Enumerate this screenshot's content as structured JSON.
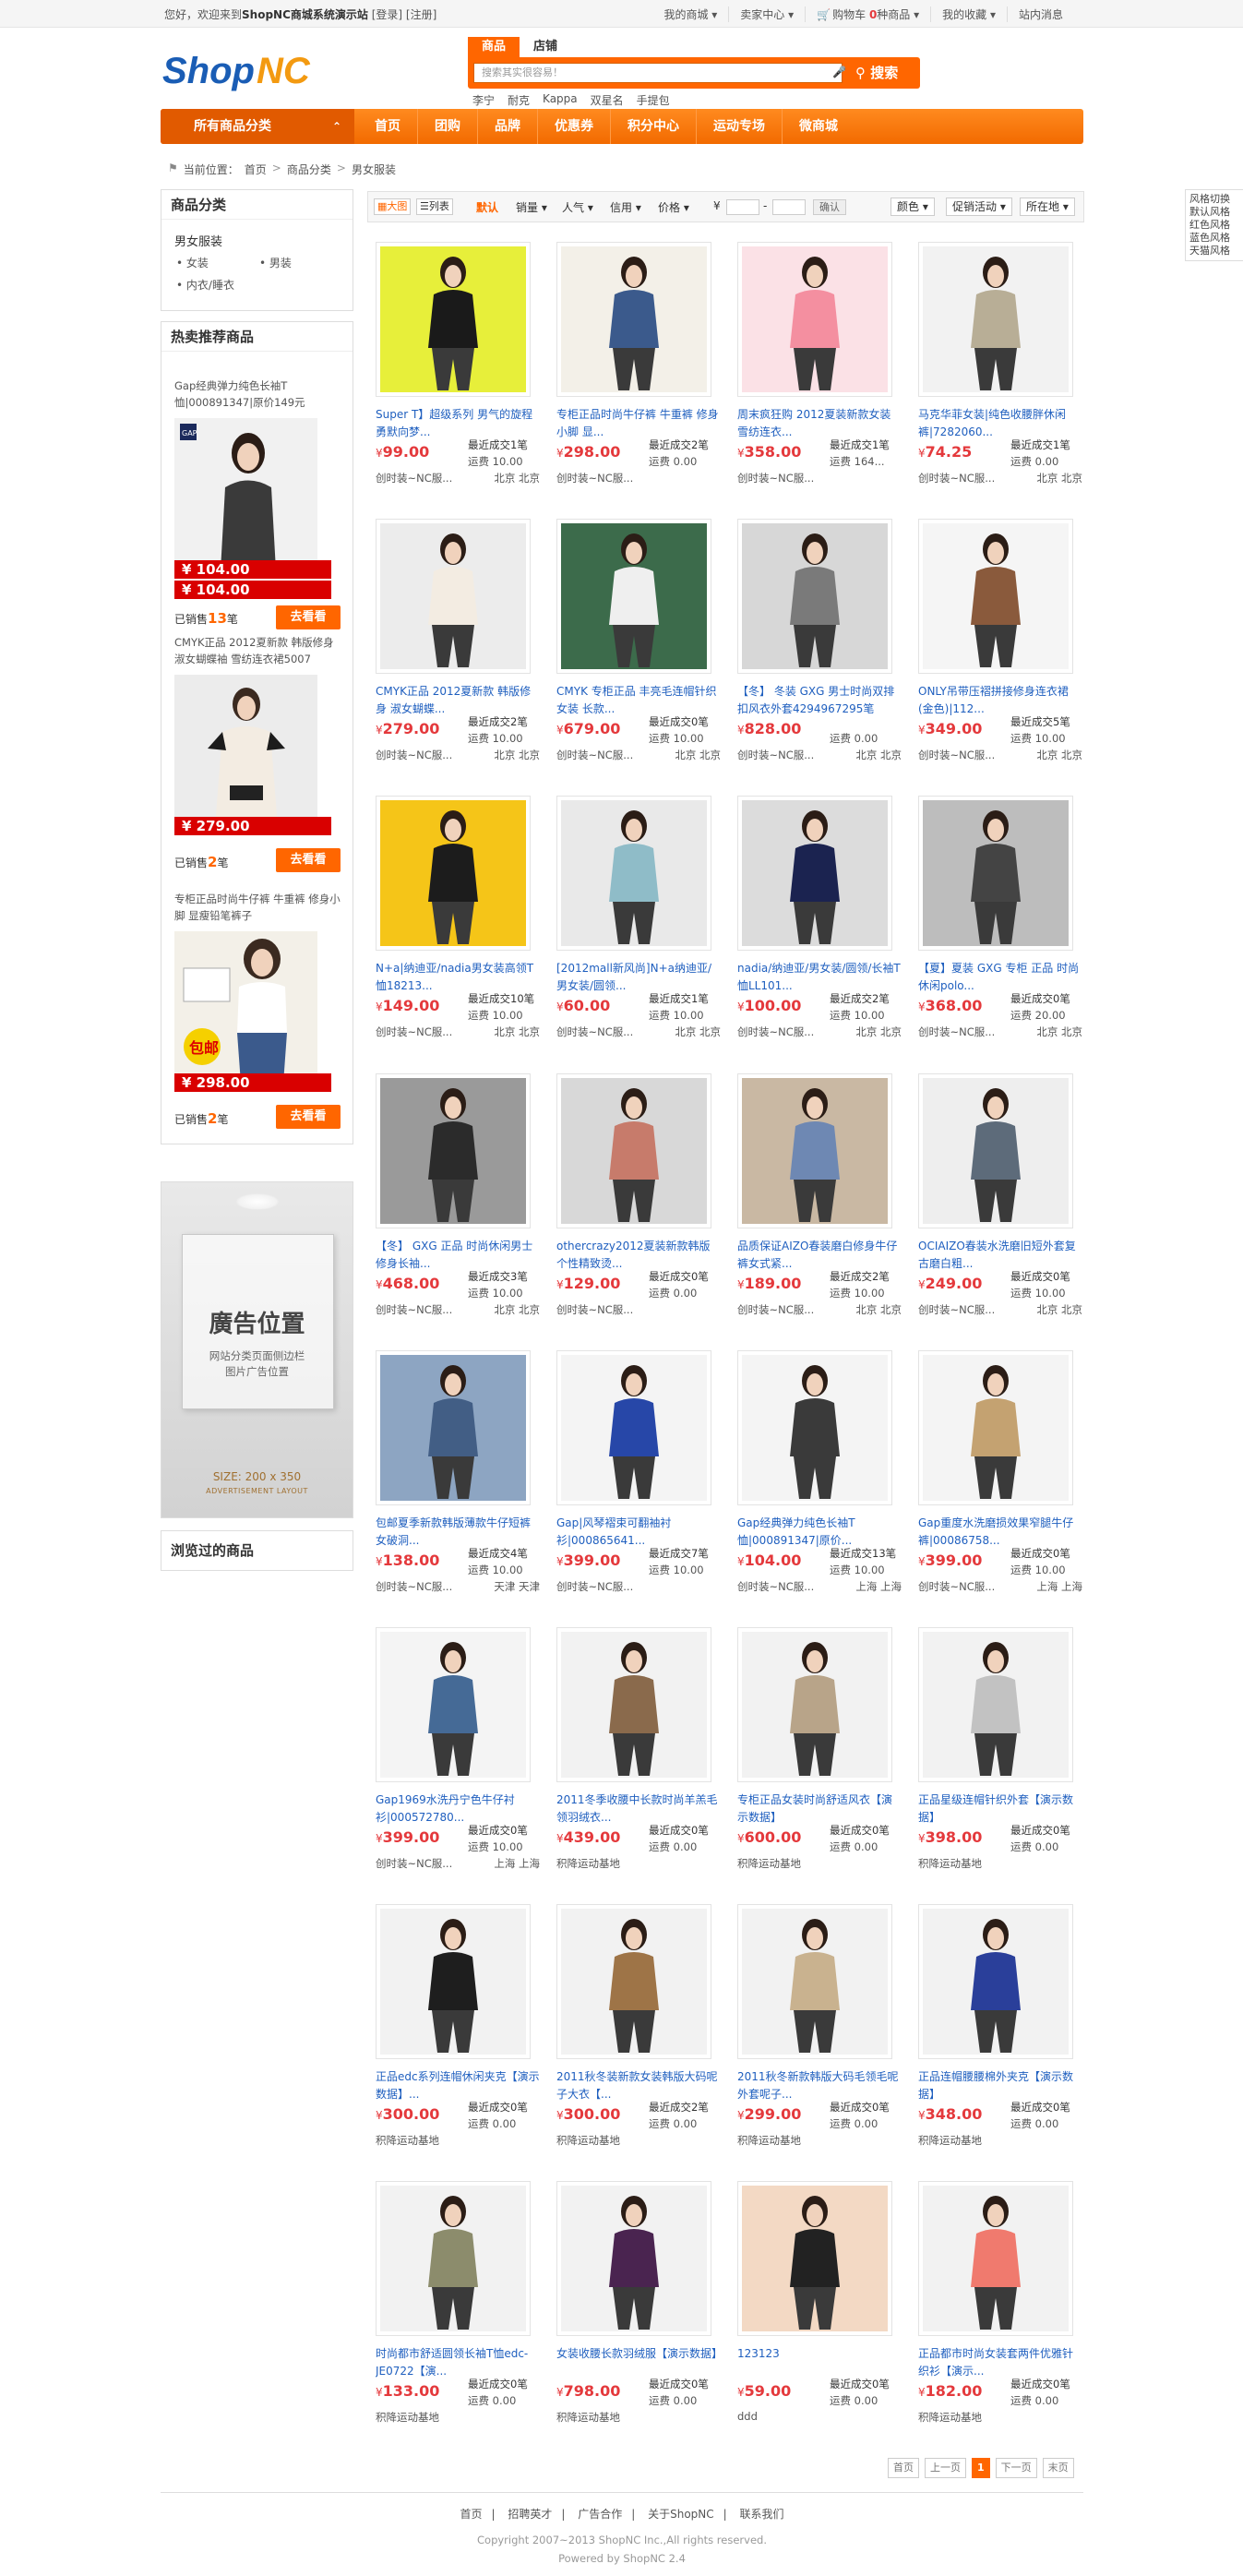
{
  "topbar": {
    "welcome": "您好，欢迎来到",
    "site_name": "ShopNC商城系统演示站",
    "login": "[登录]",
    "register": "[注册]",
    "links": [
      "我的商城 ▾",
      "卖家中心 ▾",
      "购物车",
      "我的收藏 ▾",
      "站内消息"
    ],
    "cart_count": "0",
    "cart_suffix": "种商品 ▾"
  },
  "logo": {
    "text": "ShopNC"
  },
  "search": {
    "tabs": [
      "商品",
      "店铺"
    ],
    "placeholder": "搜索其实很容易！",
    "button": "搜索",
    "hotwords": [
      "李宁",
      "耐克",
      "Kappa",
      "双星名",
      "手提包"
    ]
  },
  "nav": {
    "all_categories": "所有商品分类",
    "items": [
      "首页",
      "团购",
      "品牌",
      "优惠券",
      "积分中心",
      "运动专场",
      "微商城"
    ]
  },
  "breadcrumb": {
    "label": "当前位置：",
    "items": [
      "首页",
      "商品分类",
      "男女服装"
    ]
  },
  "style_panel": {
    "title": "风格切换",
    "items": [
      "默认风格",
      "红色风格",
      "蓝色风格",
      "天猫风格"
    ]
  },
  "sidebar": {
    "category_title": "商品分类",
    "category_main": "男女服装",
    "subcategories": [
      "女装",
      "男装",
      "内衣/睡衣"
    ],
    "hot_title": "热卖推荐商品",
    "hot_items": [
      {
        "name": "Gap经典弹力纯色长袖T恤|000891347|原价149元",
        "price": "¥ 104.00",
        "sold_prefix": "已销售",
        "sold": "13",
        "sold_suffix": "笔",
        "button": "去看看"
      },
      {
        "name": "CMYK正品 2012夏新款 韩版修身 淑女蝴蝶袖 雪纺连衣裙5007",
        "price": "¥ 279.00",
        "sold_prefix": "已销售",
        "sold": "2",
        "sold_suffix": "笔",
        "button": "去看看"
      },
      {
        "name": "专柜正品时尚牛仔裤 牛重裤 修身小脚 显瘦铅笔裤子",
        "price": "¥ 298.00",
        "sold_prefix": "已销售",
        "sold": "2",
        "sold_suffix": "笔",
        "button": "去看看"
      }
    ],
    "ad": {
      "title": "廣告位置",
      "subtitle1": "网站分类页面侧边栏",
      "subtitle2": "图片广告位置",
      "size": "SIZE: 200 x 350",
      "size_sub": "ADVERTISEMENT LAYOUT"
    },
    "viewed_title": "浏览过的商品"
  },
  "toolbar": {
    "view_grid": "大图",
    "view_list": "列表",
    "sorts": [
      "默认",
      "销量 ▾",
      "人气 ▾",
      "信用 ▾",
      "价格 ▾"
    ],
    "currency": "¥",
    "dash": "-",
    "go": "确认",
    "filters": [
      "颜色 ▾",
      "促销活动 ▾",
      "所在地 ▾"
    ]
  },
  "products": [
    {
      "name": "Super T】超级系列 男气的旋程 勇默向梦...",
      "price": "99.00",
      "sold": "最近成交1笔",
      "ship": "运费 10.00",
      "store": "创时装~NC服...",
      "loc": "北京 北京",
      "c1": "#e7ef3a",
      "c2": "#1a1a1a"
    },
    {
      "name": "专柜正品时尚牛仔裤 牛重裤 修身小脚 显...",
      "price": "298.00",
      "sold": "最近成交2笔",
      "ship": "运费 0.00",
      "store": "创时装~NC服...",
      "loc": "",
      "c1": "#f3f0e8",
      "c2": "#3b5a8c"
    },
    {
      "name": "周末疯狂购 2012夏装新款女装 雪纺连衣...",
      "price": "358.00",
      "sold": "最近成交1笔",
      "ship": "运费 164...",
      "store": "创时装~NC服...",
      "loc": "",
      "c1": "#fbe1e6",
      "c2": "#f48fa0"
    },
    {
      "name": "马克华菲女装|纯色收腰胖休闲裤|7282060...",
      "price": "74.25",
      "sold": "最近成交1笔",
      "ship": "运费 0.00",
      "store": "创时装~NC服...",
      "loc": "北京 北京",
      "c1": "#f2f2f2",
      "c2": "#b8ae96"
    },
    {
      "name": "CMYK正品 2012夏新款 韩版修身 淑女蝴蝶...",
      "price": "279.00",
      "sold": "最近成交2笔",
      "ship": "运费 10.00",
      "store": "创时装~NC服...",
      "loc": "北京 北京",
      "c1": "#ececec",
      "c2": "#f3ece2"
    },
    {
      "name": "CMYK 专柜正品 丰亮毛连帽针织女装 长款...",
      "price": "679.00",
      "sold": "最近成交0笔",
      "ship": "运费 10.00",
      "store": "创时装~NC服...",
      "loc": "北京 北京",
      "c1": "#3c6b4b",
      "c2": "#efefef"
    },
    {
      "name": "【冬】 冬装 GXG 男士时尚双排扣风衣外套4294967295笔",
      "price": "828.00",
      "sold": "",
      "ship": "运费 0.00",
      "store": "创时装~NC服...",
      "loc": "北京 北京",
      "c1": "#d7d7d7",
      "c2": "#7a7a7a"
    },
    {
      "name": "ONLY吊带压褶拼接修身连衣裙(金色)|112...",
      "price": "349.00",
      "sold": "最近成交5笔",
      "ship": "运费 10.00",
      "store": "创时装~NC服...",
      "loc": "北京 北京",
      "c1": "#f5f5f5",
      "c2": "#8a5a3c"
    },
    {
      "name": "N+a|纳迪亚/nadia男女装高领T恤18213...",
      "price": "149.00",
      "sold": "最近成交10笔",
      "ship": "运费 10.00",
      "store": "创时装~NC服...",
      "loc": "北京 北京",
      "c1": "#f5c518",
      "c2": "#1c1c1c"
    },
    {
      "name": "[2012mall新风尚]N+a纳迪亚/男女装/圆领...",
      "price": "60.00",
      "sold": "最近成交1笔",
      "ship": "运费 10.00",
      "store": "创时装~NC服...",
      "loc": "北京 北京",
      "c1": "#e9e9e9",
      "c2": "#8fbcc8"
    },
    {
      "name": "nadia/纳迪亚/男女装/圆领/长袖T恤LL101...",
      "price": "100.00",
      "sold": "最近成交2笔",
      "ship": "运费 10.00",
      "store": "创时装~NC服...",
      "loc": "北京 北京",
      "c1": "#dcdcdc",
      "c2": "#1b2350"
    },
    {
      "name": "【夏】夏装 GXG 专柜 正品 时尚休闲polo...",
      "price": "368.00",
      "sold": "最近成交0笔",
      "ship": "运费 20.00",
      "store": "创时装~NC服...",
      "loc": "北京 北京",
      "c1": "#bdbdbd",
      "c2": "#444"
    },
    {
      "name": "【冬】 GXG 正品 时尚休闲男士修身长袖...",
      "price": "468.00",
      "sold": "最近成交3笔",
      "ship": "运费 10.00",
      "store": "创时装~NC服...",
      "loc": "北京 北京",
      "c1": "#9a9a9a",
      "c2": "#2b2b2b"
    },
    {
      "name": "othercrazy2012夏装新款韩版个性精致烫...",
      "price": "129.00",
      "sold": "最近成交0笔",
      "ship": "运费 0.00",
      "store": "创时装~NC服...",
      "loc": "",
      "c1": "#d8d8d8",
      "c2": "#c77b6b"
    },
    {
      "name": "品质保证AIZO春装磨白修身牛仔裤女式紧...",
      "price": "189.00",
      "sold": "最近成交2笔",
      "ship": "运费 10.00",
      "store": "创时装~NC服...",
      "loc": "北京 北京",
      "c1": "#c9b8a3",
      "c2": "#6e88b3"
    },
    {
      "name": "OCIAIZO春装水洗磨旧短外套复古磨白粗...",
      "price": "249.00",
      "sold": "最近成交0笔",
      "ship": "运费 10.00",
      "store": "创时装~NC服...",
      "loc": "北京 北京",
      "c1": "#eeeeee",
      "c2": "#5d6b7a"
    },
    {
      "name": "包邮夏季新款韩版薄款牛仔短裤女破洞...",
      "price": "138.00",
      "sold": "最近成交4笔",
      "ship": "运费 10.00",
      "store": "创时装~NC服...",
      "loc": "天津 天津",
      "c1": "#8da5c2",
      "c2": "#425e85"
    },
    {
      "name": "Gap|风琴褶束可翻袖衬衫|000865641...",
      "price": "399.00",
      "sold": "最近成交7笔",
      "ship": "运费 10.00",
      "store": "创时装~NC服...",
      "loc": "",
      "c1": "#f4f4f4",
      "c2": "#2747a8"
    },
    {
      "name": "Gap经典弹力纯色长袖T恤|000891347|原价...",
      "price": "104.00",
      "sold": "最近成交13笔",
      "ship": "运费 10.00",
      "store": "创时装~NC服...",
      "loc": "上海 上海",
      "c1": "#f4f4f4",
      "c2": "#3a3a3a"
    },
    {
      "name": "Gap重度水洗磨损效果窄腿牛仔裤|00086758...",
      "price": "399.00",
      "sold": "最近成交0笔",
      "ship": "运费 10.00",
      "store": "创时装~NC服...",
      "loc": "上海 上海",
      "c1": "#f4f4f4",
      "c2": "#c4a271"
    },
    {
      "name": "Gap1969水洗丹宁色牛仔衬衫|000572780...",
      "price": "399.00",
      "sold": "最近成交0笔",
      "ship": "运费 10.00",
      "store": "创时装~NC服...",
      "loc": "上海 上海",
      "c1": "#f4f4f4",
      "c2": "#456a96"
    },
    {
      "name": "2011冬季收腰中长款时尚羊羔毛领羽绒衣...",
      "price": "439.00",
      "sold": "最近成交0笔",
      "ship": "运费 0.00",
      "store": "积降运动基地",
      "loc": "",
      "c1": "#f2f2f2",
      "c2": "#8a6a4c"
    },
    {
      "name": "专柜正品女装时尚舒适风衣【演示数据】",
      "price": "600.00",
      "sold": "最近成交0笔",
      "ship": "运费 0.00",
      "store": "积降运动基地",
      "loc": "",
      "c1": "#f2f2f2",
      "c2": "#b8a489"
    },
    {
      "name": "正品星级连帽针织外套【演示数据】",
      "price": "398.00",
      "sold": "最近成交0笔",
      "ship": "运费 0.00",
      "store": "积降运动基地",
      "loc": "",
      "c1": "#f2f2f2",
      "c2": "#c2c2c2"
    },
    {
      "name": "正品edc系列连帽休闲夹克【演示数据】...",
      "price": "300.00",
      "sold": "最近成交0笔",
      "ship": "运费 0.00",
      "store": "积降运动基地",
      "loc": "",
      "c1": "#f2f2f2",
      "c2": "#1e1e1e"
    },
    {
      "name": "2011秋冬装新款女装韩版大码呢子大衣【...",
      "price": "300.00",
      "sold": "最近成交2笔",
      "ship": "运费 0.00",
      "store": "积降运动基地",
      "loc": "",
      "c1": "#f2f2f2",
      "c2": "#9e7447"
    },
    {
      "name": "2011秋冬新款韩版大码毛领毛呢外套呢子...",
      "price": "299.00",
      "sold": "最近成交0笔",
      "ship": "运费 0.00",
      "store": "积降运动基地",
      "loc": "",
      "c1": "#f2f2f2",
      "c2": "#c9b28f"
    },
    {
      "name": "正品连帽腰腰棉外夹克【演示数据】",
      "price": "348.00",
      "sold": "最近成交0笔",
      "ship": "运费 0.00",
      "store": "积降运动基地",
      "loc": "",
      "c1": "#f2f2f2",
      "c2": "#2a3f9a"
    },
    {
      "name": "时尚都市舒适圆领长袖T恤edc-JE0722【演...",
      "price": "133.00",
      "sold": "最近成交0笔",
      "ship": "运费 0.00",
      "store": "积降运动基地",
      "loc": "",
      "c1": "#f2f2f2",
      "c2": "#8c8c6c"
    },
    {
      "name": "女装收腰长款羽绒服【演示数据】",
      "price": "798.00",
      "sold": "最近成交0笔",
      "ship": "运费 0.00",
      "store": "积降运动基地",
      "loc": "",
      "c1": "#f2f2f2",
      "c2": "#4a2450"
    },
    {
      "name": "123123",
      "price": "59.00",
      "sold": "最近成交0笔",
      "ship": "运费 0.00",
      "store": "ddd",
      "loc": "",
      "c1": "#f3d9c4",
      "c2": "#222"
    },
    {
      "name": "正品都市时尚女装套两件优雅针织衫【演示...",
      "price": "182.00",
      "sold": "最近成交0笔",
      "ship": "运费 0.00",
      "store": "积降运动基地",
      "loc": "",
      "c1": "#f2f2f2",
      "c2": "#f07a6e"
    }
  ],
  "pager": [
    "首页",
    "上一页",
    "1",
    "下一页",
    "末页"
  ],
  "footer": {
    "links": [
      "首页",
      "|",
      "招聘英才",
      "|",
      "广告合作",
      "|",
      "关于ShopNC",
      "|",
      "联系我们"
    ],
    "copyright": "Copyright 2007~2013 ShopNC Inc.,All rights reserved.",
    "powered": "Powered by ShopNC 2.4"
  }
}
